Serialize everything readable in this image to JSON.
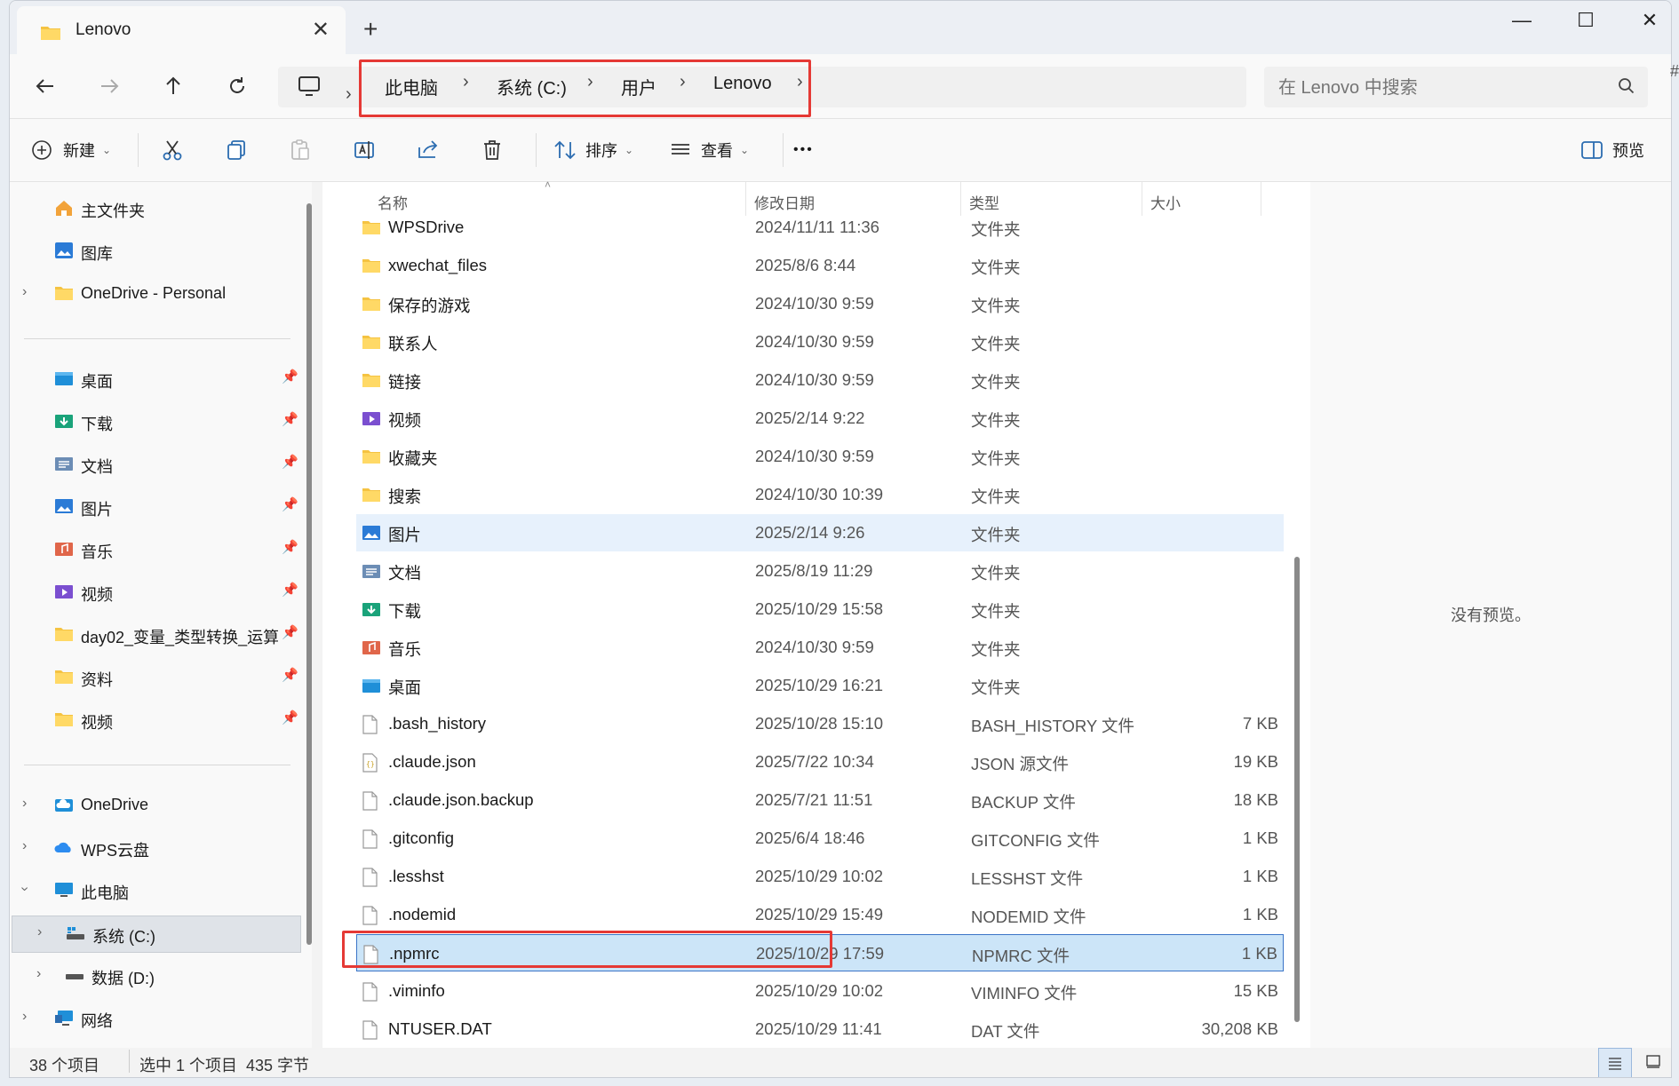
{
  "window": {
    "tab_title": "Lenovo",
    "new_tab": "+",
    "minimize": "—",
    "maximize": "☐",
    "close": "✕",
    "tab_close": "✕"
  },
  "address": {
    "crumbs": [
      "此电脑",
      "系统 (C:)",
      "用户",
      "Lenovo"
    ],
    "search_placeholder": "在 Lenovo 中搜索"
  },
  "toolbar": {
    "new_label": "新建",
    "sort_label": "排序",
    "view_label": "查看",
    "more_label": "•••",
    "preview_label": "预览"
  },
  "sidebar": {
    "top": [
      {
        "label": "主文件夹",
        "icon": "home-icon"
      },
      {
        "label": "图库",
        "icon": "gallery-icon"
      },
      {
        "label": "OneDrive - Personal",
        "icon": "folder-icon"
      }
    ],
    "pinned": [
      {
        "label": "桌面",
        "icon": "desktop-icon"
      },
      {
        "label": "下载",
        "icon": "download-icon"
      },
      {
        "label": "文档",
        "icon": "documents-icon"
      },
      {
        "label": "图片",
        "icon": "pictures-icon"
      },
      {
        "label": "音乐",
        "icon": "music-icon"
      },
      {
        "label": "视频",
        "icon": "videos-icon"
      },
      {
        "label": "day02_变量_类型转换_运算",
        "icon": "folder-icon"
      },
      {
        "label": "资料",
        "icon": "folder-icon"
      },
      {
        "label": "视频",
        "icon": "folder-icon"
      }
    ],
    "bottom": [
      {
        "label": "OneDrive",
        "icon": "cloud-icon"
      },
      {
        "label": "WPS云盘",
        "icon": "wps-cloud-icon"
      },
      {
        "label": "此电脑",
        "icon": "pc-icon"
      },
      {
        "label": "系统 (C:)",
        "icon": "drive-icon"
      },
      {
        "label": "数据 (D:)",
        "icon": "drive-icon"
      },
      {
        "label": "网络",
        "icon": "network-icon"
      }
    ]
  },
  "columns": {
    "name": "名称",
    "date": "修改日期",
    "type": "类型",
    "size": "大小"
  },
  "files": [
    {
      "name": "WPSDrive",
      "date": "2024/11/11 11:36",
      "type": "文件夹",
      "size": "",
      "icon": "folder"
    },
    {
      "name": "xwechat_files",
      "date": "2025/8/6 8:44",
      "type": "文件夹",
      "size": "",
      "icon": "folder"
    },
    {
      "name": "保存的游戏",
      "date": "2024/10/30 9:59",
      "type": "文件夹",
      "size": "",
      "icon": "folder"
    },
    {
      "name": "联系人",
      "date": "2024/10/30 9:59",
      "type": "文件夹",
      "size": "",
      "icon": "folder"
    },
    {
      "name": "链接",
      "date": "2024/10/30 9:59",
      "type": "文件夹",
      "size": "",
      "icon": "folder"
    },
    {
      "name": "视频",
      "date": "2025/2/14 9:22",
      "type": "文件夹",
      "size": "",
      "icon": "videos"
    },
    {
      "name": "收藏夹",
      "date": "2024/10/30 9:59",
      "type": "文件夹",
      "size": "",
      "icon": "folder"
    },
    {
      "name": "搜索",
      "date": "2024/10/30 10:39",
      "type": "文件夹",
      "size": "",
      "icon": "folder"
    },
    {
      "name": "图片",
      "date": "2025/2/14 9:26",
      "type": "文件夹",
      "size": "",
      "icon": "pictures"
    },
    {
      "name": "文档",
      "date": "2025/8/19 11:29",
      "type": "文件夹",
      "size": "",
      "icon": "documents"
    },
    {
      "name": "下载",
      "date": "2025/10/29 15:58",
      "type": "文件夹",
      "size": "",
      "icon": "download"
    },
    {
      "name": "音乐",
      "date": "2024/10/30 9:59",
      "type": "文件夹",
      "size": "",
      "icon": "music"
    },
    {
      "name": "桌面",
      "date": "2025/10/29 16:21",
      "type": "文件夹",
      "size": "",
      "icon": "desktop"
    },
    {
      "name": ".bash_history",
      "date": "2025/10/28 15:10",
      "type": "BASH_HISTORY 文件",
      "size": "7 KB",
      "icon": "file"
    },
    {
      "name": ".claude.json",
      "date": "2025/7/22 10:34",
      "type": "JSON 源文件",
      "size": "19 KB",
      "icon": "json"
    },
    {
      "name": ".claude.json.backup",
      "date": "2025/7/21 11:51",
      "type": "BACKUP 文件",
      "size": "18 KB",
      "icon": "file"
    },
    {
      "name": ".gitconfig",
      "date": "2025/6/4 18:46",
      "type": "GITCONFIG 文件",
      "size": "1 KB",
      "icon": "file"
    },
    {
      "name": ".lesshst",
      "date": "2025/10/29 10:02",
      "type": "LESSHST 文件",
      "size": "1 KB",
      "icon": "file"
    },
    {
      "name": ".nodemid",
      "date": "2025/10/29 15:49",
      "type": "NODEMID 文件",
      "size": "1 KB",
      "icon": "file"
    },
    {
      "name": ".npmrc",
      "date": "2025/10/29 17:59",
      "type": "NPMRC 文件",
      "size": "1 KB",
      "icon": "file"
    },
    {
      "name": ".viminfo",
      "date": "2025/10/29 10:02",
      "type": "VIMINFO 文件",
      "size": "15 KB",
      "icon": "file"
    },
    {
      "name": "NTUSER.DAT",
      "date": "2025/10/29 11:41",
      "type": "DAT 文件",
      "size": "30,208 KB",
      "icon": "file"
    }
  ],
  "preview": {
    "message": "没有预览。"
  },
  "status": {
    "count": "38 个项目",
    "selection": "选中 1 个项目  435 字节"
  },
  "colors": {
    "folder": "#f5c342",
    "selection": "#cce5f8",
    "highlight_box": "#e53935",
    "accent": "#3a74c7"
  }
}
